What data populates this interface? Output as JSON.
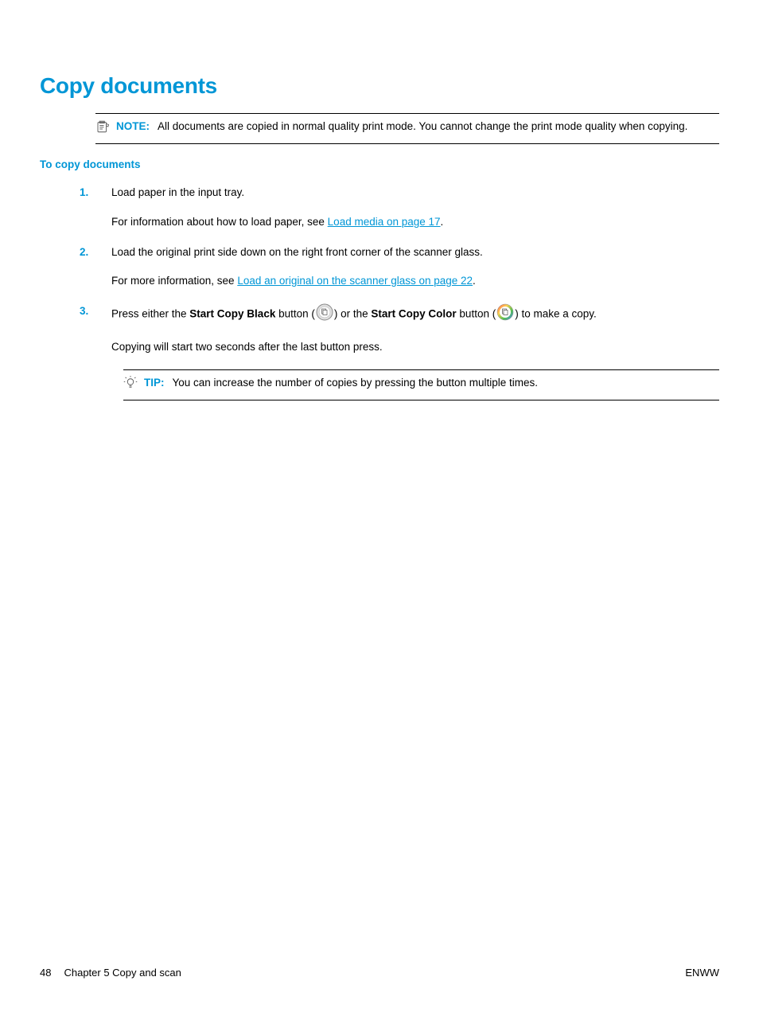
{
  "heading": "Copy documents",
  "note": {
    "label": "NOTE:",
    "text": "All documents are copied in normal quality print mode. You cannot change the print mode quality when copying."
  },
  "subheading": "To copy documents",
  "steps": {
    "s1": {
      "num": "1.",
      "p1": "Load paper in the input tray.",
      "p2a": "For information about how to load paper, see ",
      "p2link": "Load media on page 17",
      "p2b": "."
    },
    "s2": {
      "num": "2.",
      "p1": "Load the original print side down on the right front corner of the scanner glass.",
      "p2a": "For more information, see ",
      "p2link": "Load an original on the scanner glass on page 22",
      "p2b": "."
    },
    "s3": {
      "num": "3.",
      "p1a": "Press either the ",
      "p1b": "Start Copy Black",
      "p1c": " button (",
      "p1d": ") or the ",
      "p1e": "Start Copy Color",
      "p1f": " button (",
      "p1g": ") to make a copy.",
      "p2": "Copying will start two seconds after the last button press."
    }
  },
  "tip": {
    "label": "TIP:",
    "text": "You can increase the number of copies by pressing the button multiple times."
  },
  "footer": {
    "pageNum": "48",
    "chapter": "Chapter 5   Copy and scan",
    "region": "ENWW"
  }
}
